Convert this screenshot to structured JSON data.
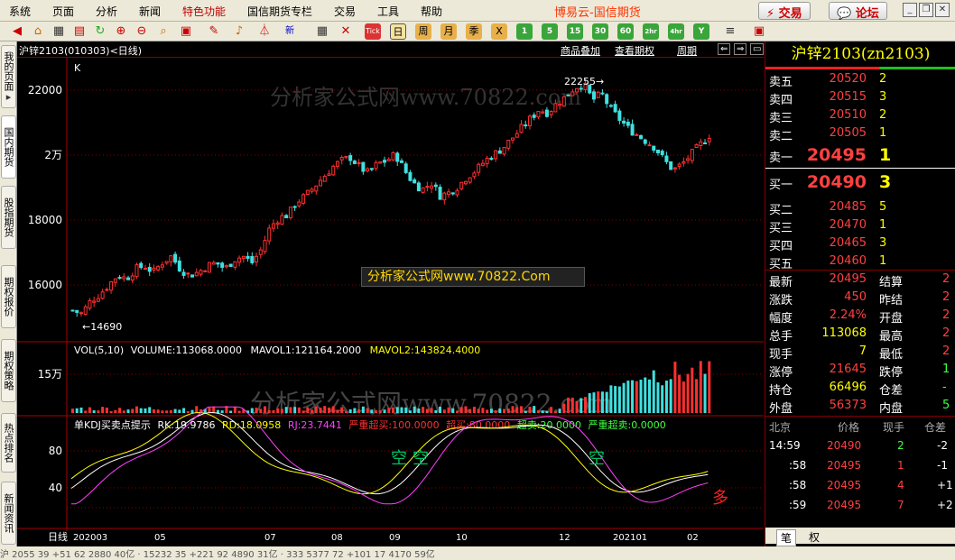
{
  "menu": [
    "系统",
    "页面",
    "分析",
    "新闻",
    "特色功能",
    "国信期货专栏",
    "交易",
    "工具",
    "帮助"
  ],
  "brand": "博易云-国信期货",
  "buttons": {
    "trade": "交易",
    "forum": "论坛"
  },
  "toolbar": {
    "periods": [
      "日",
      "周",
      "月",
      "季",
      "X",
      "1",
      "5",
      "15",
      "30",
      "60",
      "2hr",
      "4hr",
      "Y"
    ],
    "tick_label": "Tick"
  },
  "sidebar_tabs": [
    "我的页面",
    "国内期货",
    "股指期货",
    "期权报价",
    "期权策略",
    "热点排名",
    "新闻资讯"
  ],
  "chart_header": {
    "title": "沪锌2103(010303)<日线)",
    "links": [
      "商品叠加",
      "查看期权",
      "周期"
    ]
  },
  "price_axis": [
    "22000",
    "2万",
    "18000",
    "16000"
  ],
  "annotations": {
    "high": "22255→",
    "low": "←14690",
    "k": "K",
    "watermark_top": "分析家公式网www.70822.com",
    "watermark_mid": "分析家公式网www.70822.Com",
    "watermark_vol": "分析家公式网www.70822.com"
  },
  "vol_header": {
    "name": "VOL(5,10)",
    "volume": "VOLUME:113068.0000",
    "mavol1": "MAVOL1:121164.2000",
    "mavol2": "MAVOL2:143824.4000",
    "axis": "15万"
  },
  "kdj_header": {
    "name": "单KDJ买卖点提示",
    "rk": "RK:19.9786",
    "rd": "RD:18.0958",
    "rj": "RJ:23.7441",
    "s1": "严重超买:100.0000",
    "s2": "超买:80.0000",
    "s3": "超卖:20.0000",
    "s4": "严重超卖:0.0000",
    "axis": [
      "80",
      "40"
    ],
    "sig1": "空",
    "sig2": "空",
    "sig3": "空",
    "sig4": "多"
  },
  "x_axis": {
    "label": "日线",
    "ticks": [
      "202003",
      "05",
      "07",
      "08",
      "09",
      "10",
      "12",
      "202101",
      "02"
    ]
  },
  "quote": {
    "title": "沪锌2103(zn2103)",
    "asks": [
      {
        "label": "卖五",
        "price": "20520",
        "vol": "2"
      },
      {
        "label": "卖四",
        "price": "20515",
        "vol": "3"
      },
      {
        "label": "卖三",
        "price": "20510",
        "vol": "2"
      },
      {
        "label": "卖二",
        "price": "20505",
        "vol": "1"
      },
      {
        "label": "卖一",
        "price": "20495",
        "vol": "1"
      }
    ],
    "bids": [
      {
        "label": "买一",
        "price": "20490",
        "vol": "3"
      },
      {
        "label": "买二",
        "price": "20485",
        "vol": "5"
      },
      {
        "label": "买三",
        "price": "20470",
        "vol": "1"
      },
      {
        "label": "买四",
        "price": "20465",
        "vol": "3"
      },
      {
        "label": "买五",
        "price": "20460",
        "vol": "1"
      }
    ],
    "stats": [
      {
        "k": "最新",
        "v": "20495",
        "k2": "结算",
        "v2": "2"
      },
      {
        "k": "涨跌",
        "v": "450",
        "k2": "昨结",
        "v2": "2"
      },
      {
        "k": "幅度",
        "v": "2.24%",
        "k2": "开盘",
        "v2": "2"
      },
      {
        "k": "总手",
        "v": "113068",
        "k2": "最高",
        "v2": "2"
      },
      {
        "k": "现手",
        "v": "7",
        "k2": "最低",
        "v2": "2"
      },
      {
        "k": "涨停",
        "v": "21645",
        "k2": "跌停",
        "v2": "1"
      },
      {
        "k": "持仓",
        "v": "66496",
        "k2": "仓差",
        "v2": "-"
      },
      {
        "k": "外盘",
        "v": "56373",
        "k2": "内盘",
        "v2": "5"
      }
    ],
    "tick_header": [
      "北京",
      "价格",
      "现手",
      "仓差"
    ],
    "ticks": [
      {
        "t": "14:59",
        "p": "20490",
        "v": "2",
        "c": "-2"
      },
      {
        "t": ":58",
        "p": "20495",
        "v": "1",
        "c": "-1"
      },
      {
        "t": ":58",
        "p": "20495",
        "v": "4",
        "c": "+1"
      },
      {
        "t": ":59",
        "p": "20495",
        "v": "7",
        "c": "+2"
      }
    ],
    "bottom_tabs": [
      "笔",
      "权"
    ]
  },
  "status_text": "沪  2055 39   +51 62  2880 40亿   ·  15232 35   +221 92  4890 31亿   ·  333 5377 72  +101 17  4170 59亿",
  "chart_data": {
    "type": "candlestick",
    "title": "沪锌2103 日线",
    "ylim": [
      14300,
      22700
    ],
    "x_ticks": [
      "202003",
      "05",
      "07",
      "08",
      "09",
      "10",
      "12",
      "202101",
      "02"
    ],
    "close_path": [
      15000,
      14900,
      15300,
      15500,
      15800,
      16100,
      16000,
      16300,
      16400,
      16200,
      16500,
      16700,
      16300,
      16100,
      16200,
      16400,
      16500,
      16300,
      16600,
      16700,
      16500,
      16900,
      17600,
      17900,
      18000,
      18400,
      18600,
      18900,
      19200,
      19500,
      19700,
      19800,
      19500,
      19300,
      19600,
      19700,
      19900,
      19400,
      19000,
      18800,
      19000,
      18600,
      18700,
      18900,
      19200,
      19400,
      19700,
      19900,
      20100,
      20400,
      20700,
      21000,
      21300,
      21200,
      21500,
      21700,
      22000,
      22100,
      21600,
      21800,
      21300,
      21000,
      20700,
      20500,
      20300,
      20100,
      19700,
      19400,
      19600,
      19900,
      20200,
      20495
    ],
    "high": 22255,
    "low": 14690,
    "volume_axis": "15万",
    "kdj_levels": [
      100,
      80,
      20,
      0
    ]
  }
}
